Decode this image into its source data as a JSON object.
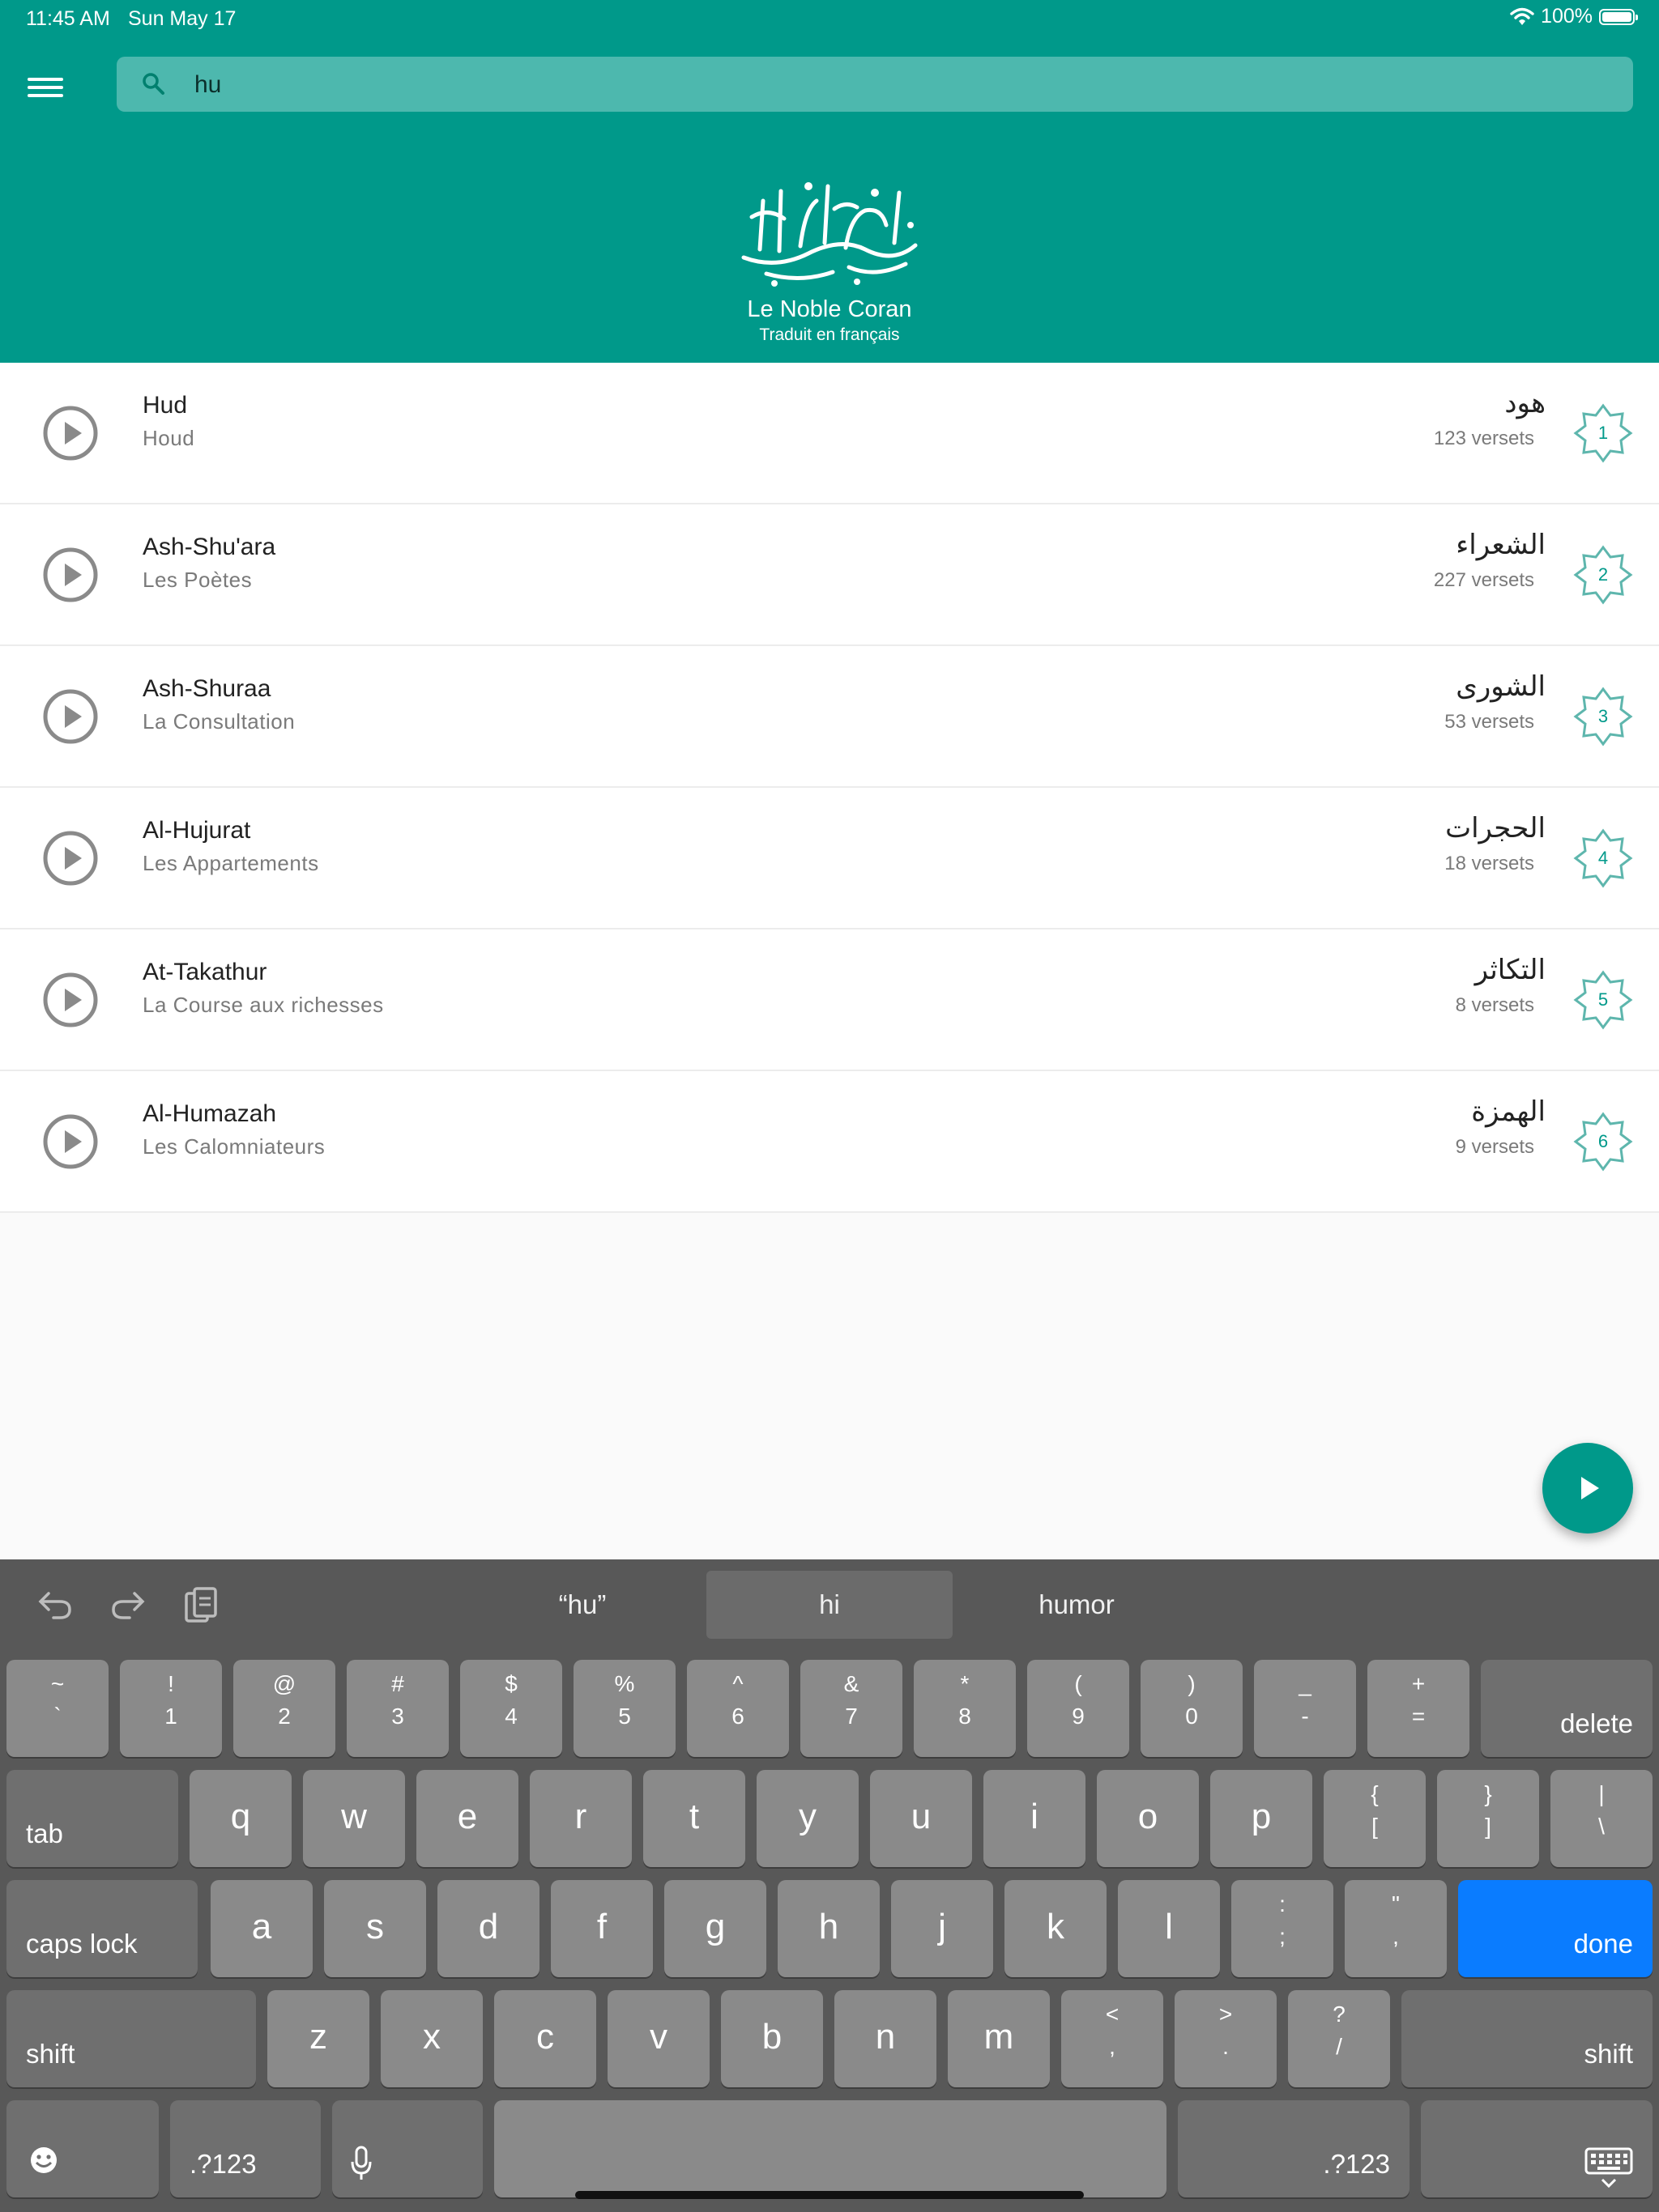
{
  "status": {
    "time": "11:45 AM",
    "date": "Sun May 17",
    "battery": "100%"
  },
  "header": {
    "search_value": "hu",
    "title": "Le Noble Coran",
    "subtitle": "Traduit en français"
  },
  "surahs": [
    {
      "name": "Hud",
      "translation": "Houd",
      "arabic": "هود",
      "verses": "123 versets",
      "number": "1"
    },
    {
      "name": "Ash-Shu'ara",
      "translation": "Les Poètes",
      "arabic": "الشعراء",
      "verses": "227 versets",
      "number": "2"
    },
    {
      "name": "Ash-Shuraa",
      "translation": "La Consultation",
      "arabic": "الشورى",
      "verses": "53 versets",
      "number": "3"
    },
    {
      "name": "Al-Hujurat",
      "translation": "Les Appartements",
      "arabic": "الحجرات",
      "verses": "18 versets",
      "number": "4"
    },
    {
      "name": "At-Takathur",
      "translation": "La Course aux richesses",
      "arabic": "التكاثر",
      "verses": "8 versets",
      "number": "5"
    },
    {
      "name": "Al-Humazah",
      "translation": "Les Calomniateurs",
      "arabic": "الهمزة",
      "verses": "9 versets",
      "number": "6"
    }
  ],
  "keyboard": {
    "suggestions": [
      "“hu”",
      "hi",
      "humor"
    ],
    "number_row": [
      {
        "top": "~",
        "bottom": "`"
      },
      {
        "top": "!",
        "bottom": "1"
      },
      {
        "top": "@",
        "bottom": "2"
      },
      {
        "top": "#",
        "bottom": "3"
      },
      {
        "top": "$",
        "bottom": "4"
      },
      {
        "top": "%",
        "bottom": "5"
      },
      {
        "top": "^",
        "bottom": "6"
      },
      {
        "top": "&",
        "bottom": "7"
      },
      {
        "top": "*",
        "bottom": "8"
      },
      {
        "top": "(",
        "bottom": "9"
      },
      {
        "top": ")",
        "bottom": "0"
      },
      {
        "top": "_",
        "bottom": "-"
      },
      {
        "top": "+",
        "bottom": "="
      }
    ],
    "row_q": [
      "q",
      "w",
      "e",
      "r",
      "t",
      "y",
      "u",
      "i",
      "o",
      "p"
    ],
    "row_q_symbols": [
      {
        "top": "{",
        "bottom": "["
      },
      {
        "top": "}",
        "bottom": "]"
      },
      {
        "top": "|",
        "bottom": "\\"
      }
    ],
    "row_a": [
      "a",
      "s",
      "d",
      "f",
      "g",
      "h",
      "j",
      "k",
      "l"
    ],
    "row_a_symbols": [
      {
        "top": ":",
        "bottom": ";"
      },
      {
        "top": "\"",
        "bottom": ","
      }
    ],
    "row_z": [
      "z",
      "x",
      "c",
      "v",
      "b",
      "n",
      "m"
    ],
    "row_z_symbols": [
      {
        "top": "<",
        "bottom": ","
      },
      {
        "top": ">",
        "bottom": "."
      },
      {
        "top": "?",
        "bottom": "/"
      }
    ],
    "labels": {
      "delete": "delete",
      "tab": "tab",
      "caps_lock": "caps lock",
      "done": "done",
      "shift": "shift",
      "numbers": ".?123"
    },
    "colors": {
      "return_key": "#0a7cff"
    }
  },
  "theme": {
    "primary": "#00998a"
  }
}
